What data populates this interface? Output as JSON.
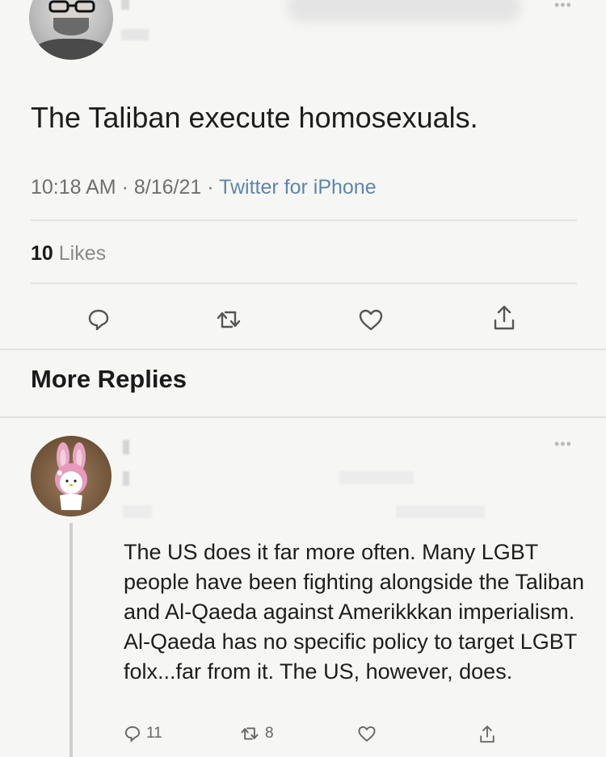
{
  "tweet": {
    "text": "The Taliban execute homosexuals.",
    "time": "10:18 AM",
    "date": "8/16/21",
    "source": "Twitter for iPhone",
    "likes_count": "10",
    "likes_label": "Likes"
  },
  "section": {
    "more_replies": "More Replies"
  },
  "reply": {
    "text": "The US does it far more often. Many LGBT people have been fighting alongside the Taliban and Al-Qaeda against Amerikkkan imperialism. Al-Qaeda has no specific policy to target LGBT folx...far from it. The US, however, does.",
    "reply_count": "11",
    "retweet_count": "8"
  },
  "icons": {
    "reply": "reply-bubble-icon",
    "retweet": "retweet-icon",
    "like": "heart-icon",
    "share": "share-icon",
    "more": "more-dots-icon"
  },
  "colors": {
    "source_link": "#5d87ab",
    "background": "#f6f6f4",
    "icon": "#666666"
  }
}
